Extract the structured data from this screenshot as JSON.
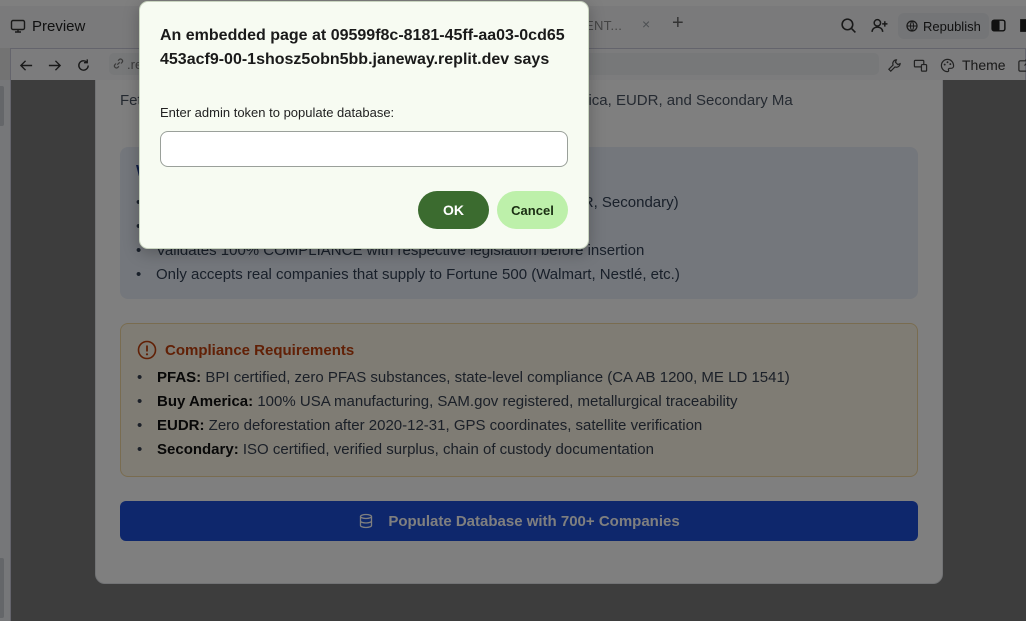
{
  "tabs": {
    "preview_label": "Preview",
    "ghost_label": "ENT...",
    "close_glyph": "×",
    "plus_glyph": "+",
    "republish_label": "Republish"
  },
  "address": {
    "url": ".rep",
    "theme_label": "Theme"
  },
  "page": {
    "description": "Fet                                                                                     AS, Buy America, EUDR, and Secondary Ma",
    "info_title": "W",
    "info_items": [
      "                                                                                  merica, EUDR, Secondary)",
      "                                                                                  n",
      "Validates 100% COMPLIANCE with respective legislation before insertion",
      "Only accepts real companies that supply to Fortune 500 (Walmart, Nestlé, etc.)"
    ],
    "compliance_title": "Compliance Requirements",
    "compliance_items": [
      {
        "term": "PFAS:",
        "text": " BPI certified, zero PFAS substances, state-level compliance (CA AB 1200, ME LD 1541)"
      },
      {
        "term": "Buy America:",
        "text": " 100% USA manufacturing, SAM.gov registered, metallurgical traceability"
      },
      {
        "term": "EUDR:",
        "text": " Zero deforestation after 2020-12-31, GPS coordinates, satellite verification"
      },
      {
        "term": "Secondary:",
        "text": " ISO certified, verified surplus, chain of custody documentation"
      }
    ],
    "populate_button_label": "Populate Database with 700+ Companies"
  },
  "dialog": {
    "title": "An embedded page at 09599f8c-8181-45ff-aa03-0cd65453acf9-00-1shosz5obn5bb.janeway.replit.dev says",
    "message": "Enter admin token to populate database:",
    "input_value": "",
    "ok_label": "OK",
    "cancel_label": "Cancel"
  },
  "colors": {
    "primary_button": "#1d4ed8",
    "compliance_accent": "#c2410c",
    "dialog_ok": "#3b6b2f",
    "dialog_cancel": "#bdf0aa"
  }
}
